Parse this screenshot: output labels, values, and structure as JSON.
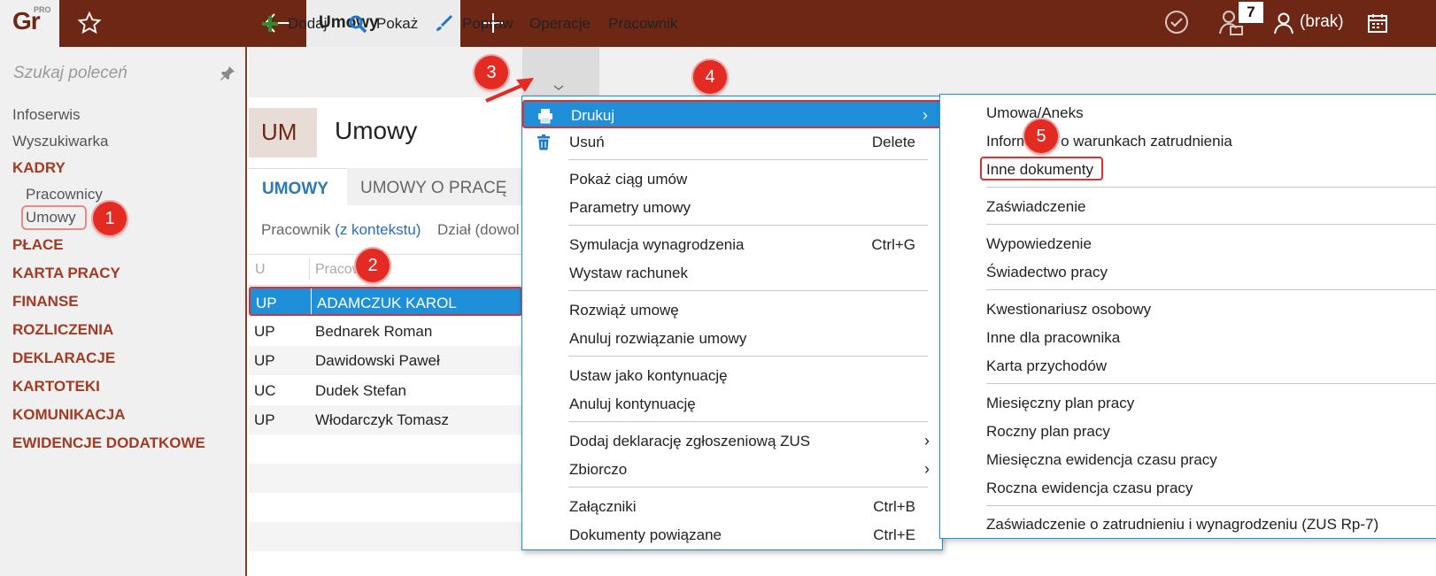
{
  "app": {
    "logo_text": "Gr",
    "logo_sup": "PRO",
    "tab_title": "Umowy",
    "badge_count": "7",
    "user_label": "(brak)"
  },
  "sidebar": {
    "search_placeholder": "Szukaj poleceń",
    "items": [
      {
        "label": "Infoserwis",
        "kind": "plain"
      },
      {
        "label": "Wyszukiwarka",
        "kind": "plain"
      },
      {
        "label": "KADRY",
        "kind": "section"
      },
      {
        "label": "Pracownicy",
        "kind": "sub"
      },
      {
        "label": "Umowy",
        "kind": "sub"
      },
      {
        "label": "PŁACE",
        "kind": "section"
      },
      {
        "label": "KARTA PRACY",
        "kind": "section"
      },
      {
        "label": "FINANSE",
        "kind": "section"
      },
      {
        "label": "ROZLICZENIA",
        "kind": "section"
      },
      {
        "label": "DEKLARACJE",
        "kind": "section"
      },
      {
        "label": "KARTOTEKI",
        "kind": "section"
      },
      {
        "label": "KOMUNIKACJA",
        "kind": "section"
      },
      {
        "label": "EWIDENCJE DODATKOWE",
        "kind": "section"
      }
    ]
  },
  "toolbar": {
    "add": "Dodaj",
    "show": "Pokaż",
    "edit": "Popraw",
    "operations": "Operacje",
    "employee": "Pracownik"
  },
  "main": {
    "badge": "UM",
    "title": "Umowy",
    "tabs": [
      "UMOWY",
      "UMOWY O PRACĘ"
    ],
    "filter_employee": "Pracownik",
    "filter_employee_value": "(z kontekstu)",
    "filter_dept": "Dział (dowol",
    "columns": [
      "U",
      "Pracownik"
    ],
    "rows": [
      {
        "type": "UP",
        "name": "ADAMCZUK KAROL"
      },
      {
        "type": "UP",
        "name": "Bednarek Roman"
      },
      {
        "type": "UP",
        "name": "Dawidowski Paweł"
      },
      {
        "type": "UC",
        "name": "Dudek Stefan"
      },
      {
        "type": "UP",
        "name": "Włodarczyk Tomasz"
      }
    ]
  },
  "menu": {
    "print": "Drukuj",
    "delete": "Usuń",
    "delete_sc": "Delete",
    "show_chain": "Pokaż ciąg umów",
    "params": "Parametry umowy",
    "simulation": "Symulacja wynagrodzenia",
    "simulation_sc": "Ctrl+G",
    "invoice": "Wystaw rachunek",
    "terminate": "Rozwiąż umowę",
    "cancel_terminate": "Anuluj rozwiązanie umowy",
    "set_continuation": "Ustaw jako kontynuację",
    "cancel_continuation": "Anuluj kontynuację",
    "add_zus": "Dodaj deklarację zgłoszeniową ZUS",
    "bulk": "Zbiorczo",
    "attachments": "Załączniki",
    "attachments_sc": "Ctrl+B",
    "related_docs": "Dokumenty powiązane",
    "related_docs_sc": "Ctrl+E"
  },
  "submenu": {
    "items": [
      "Umowa/Aneks",
      "Informacja o warunkach zatrudnienia",
      "Inne dokumenty",
      "Zaświadczenie",
      "Wypowiedzenie",
      "Świadectwo pracy",
      "Kwestionariusz osobowy",
      "Inne dla pracownika",
      "Karta przychodów",
      "Miesięczny plan pracy",
      "Roczny plan pracy",
      "Miesięczna ewidencja czasu pracy",
      "Roczna ewidencja czasu pracy",
      "Zaświadczenie o zatrudnieniu i wynagrodzeniu (ZUS Rp-7)"
    ]
  },
  "steps": [
    "1",
    "2",
    "3",
    "4",
    "5"
  ],
  "colors": {
    "brand": "#6e2715",
    "accent": "#1e8fd8",
    "marker": "#e32b24",
    "section": "#a33a24"
  }
}
